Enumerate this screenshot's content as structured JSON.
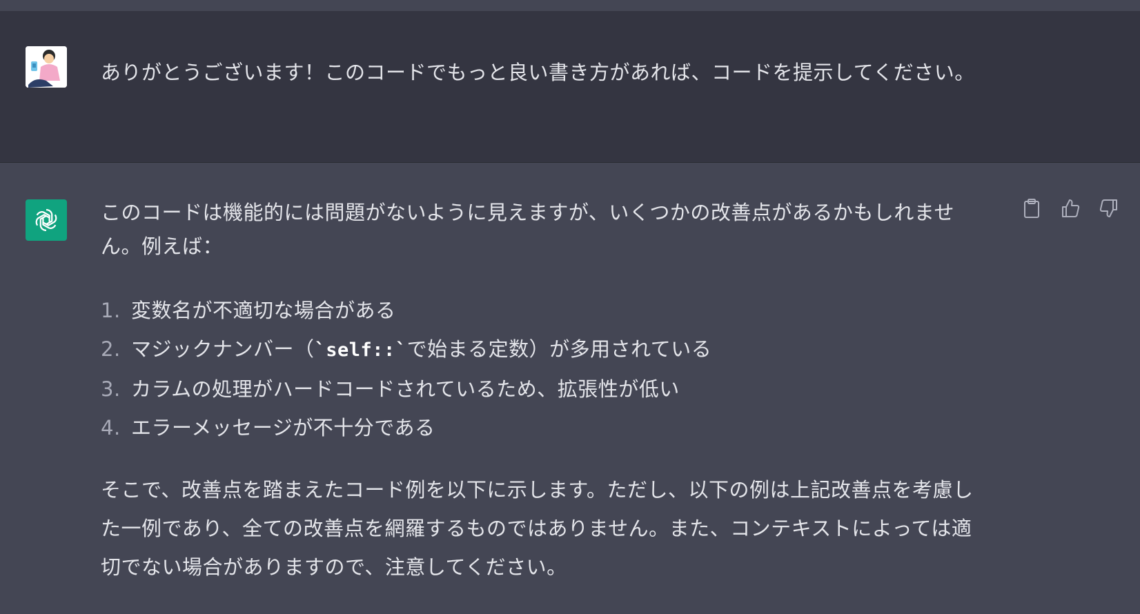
{
  "user_message": {
    "avatar_icon": "user-avatar-illustration",
    "text": "ありがとうございます！このコードでもっと良い書き方があれば、コードを提示してください。"
  },
  "assistant_message": {
    "avatar_icon": "chatgpt-logo-icon",
    "avatar_color": "#10a37f",
    "intro": "このコードは機能的には問題がないように見えますが、いくつかの改善点があるかもしれません。例えば：",
    "points": [
      {
        "num": "1.",
        "text": "変数名が不適切な場合がある"
      },
      {
        "num": "2.",
        "text_before": "マジックナンバー（",
        "code": "`self::`",
        "text_after": "で始まる定数）が多用されている"
      },
      {
        "num": "3.",
        "text": "カラムの処理がハードコードされているため、拡張性が低い"
      },
      {
        "num": "4.",
        "text": "エラーメッセージが不十分である"
      }
    ],
    "outro": "そこで、改善点を踏まえたコード例を以下に示します。ただし、以下の例は上記改善点を考慮した一例であり、全ての改善点を網羅するものではありません。また、コンテキストによっては適切でない場合がありますので、注意してください。",
    "actions": [
      {
        "icon": "clipboard-icon"
      },
      {
        "icon": "thumbs-up-icon"
      },
      {
        "icon": "thumbs-down-icon"
      }
    ]
  },
  "colors": {
    "user_bg": "#343541",
    "assistant_bg": "#444654",
    "text": "#e4e5ea"
  }
}
